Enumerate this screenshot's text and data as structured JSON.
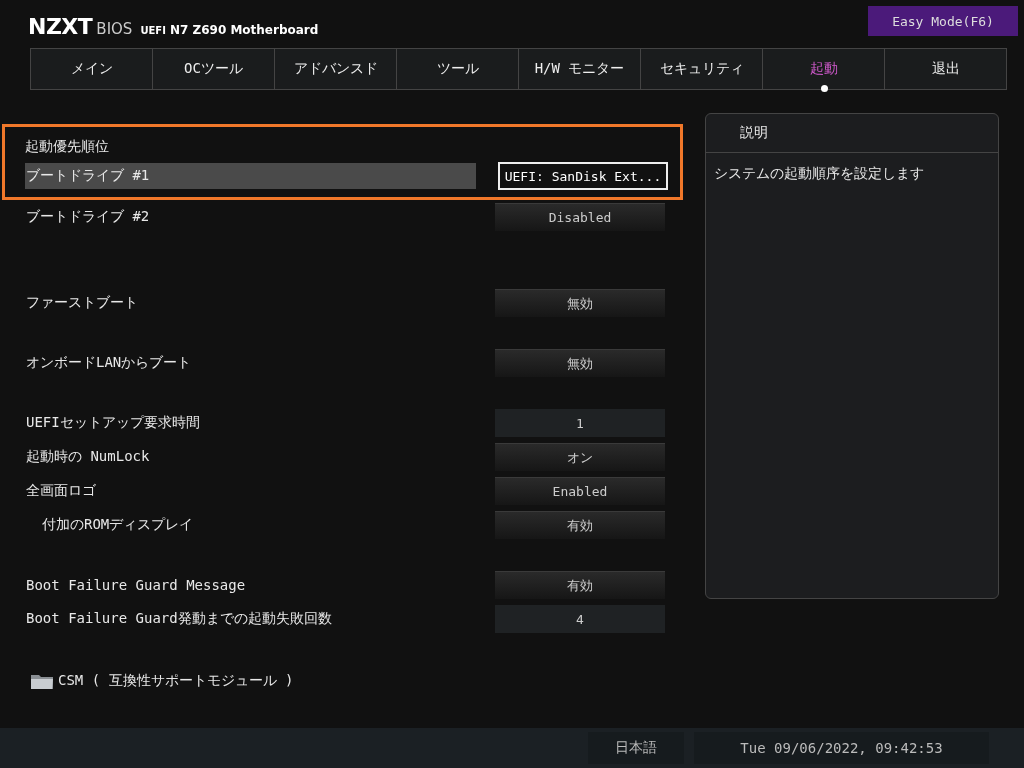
{
  "header": {
    "brand": "NZXT",
    "product": "BIOS",
    "firmware": "UEFI",
    "board": "N7 Z690 Motherboard",
    "mode_button": "Easy Mode(F6)"
  },
  "tabs": [
    {
      "label": "メイン",
      "selected": false
    },
    {
      "label": "OCツール",
      "selected": false
    },
    {
      "label": "アドバンスド",
      "selected": false
    },
    {
      "label": "ツール",
      "selected": false
    },
    {
      "label": "H/W モニター",
      "selected": false
    },
    {
      "label": "セキュリティ",
      "selected": false
    },
    {
      "label": "起動",
      "selected": true
    },
    {
      "label": "退出",
      "selected": false
    }
  ],
  "groups": [
    {
      "heading": "起動優先順位",
      "highlighted": true,
      "items": [
        {
          "label": "ブートドライブ #1",
          "value": "UEFI: SanDisk Ext...",
          "kind": "dropdown",
          "selected": true
        }
      ]
    },
    {
      "highlighted": false,
      "items": [
        {
          "label": "ブートドライブ #2",
          "value": "Disabled",
          "kind": "dropdown",
          "selected": false
        }
      ]
    },
    {
      "highlighted": false,
      "items": [
        {
          "label": "ファーストブート",
          "value": "無効",
          "kind": "dropdown",
          "selected": false
        }
      ]
    },
    {
      "highlighted": false,
      "items": [
        {
          "label": "オンボードLANからブート",
          "value": "無効",
          "kind": "dropdown",
          "selected": false
        }
      ]
    },
    {
      "highlighted": false,
      "items": [
        {
          "label": "UEFIセットアップ要求時間",
          "value": "1",
          "kind": "number",
          "selected": false
        },
        {
          "label": "起動時の NumLock",
          "value": "オン",
          "kind": "dropdown",
          "selected": false
        },
        {
          "label": "全画面ロゴ",
          "value": "Enabled",
          "kind": "dropdown",
          "selected": false,
          "children": [
            {
              "label": "付加のROMディスプレイ",
              "value": "有効",
              "kind": "dropdown",
              "selected": false
            }
          ]
        }
      ]
    },
    {
      "highlighted": false,
      "items": [
        {
          "label": "Boot Failure Guard Message",
          "value": "有効",
          "kind": "dropdown",
          "selected": false
        },
        {
          "label": "Boot Failure Guard発動までの起動失敗回数",
          "value": "4",
          "kind": "number",
          "selected": false
        }
      ]
    }
  ],
  "submenu": {
    "label": "CSM ( 互換性サポートモジュール )"
  },
  "help_panel": {
    "title": "説明",
    "text": "システムの起動順序を設定します"
  },
  "status_bar": {
    "language": "日本語",
    "datetime": "Tue 09/06/2022, 09:42:53"
  }
}
